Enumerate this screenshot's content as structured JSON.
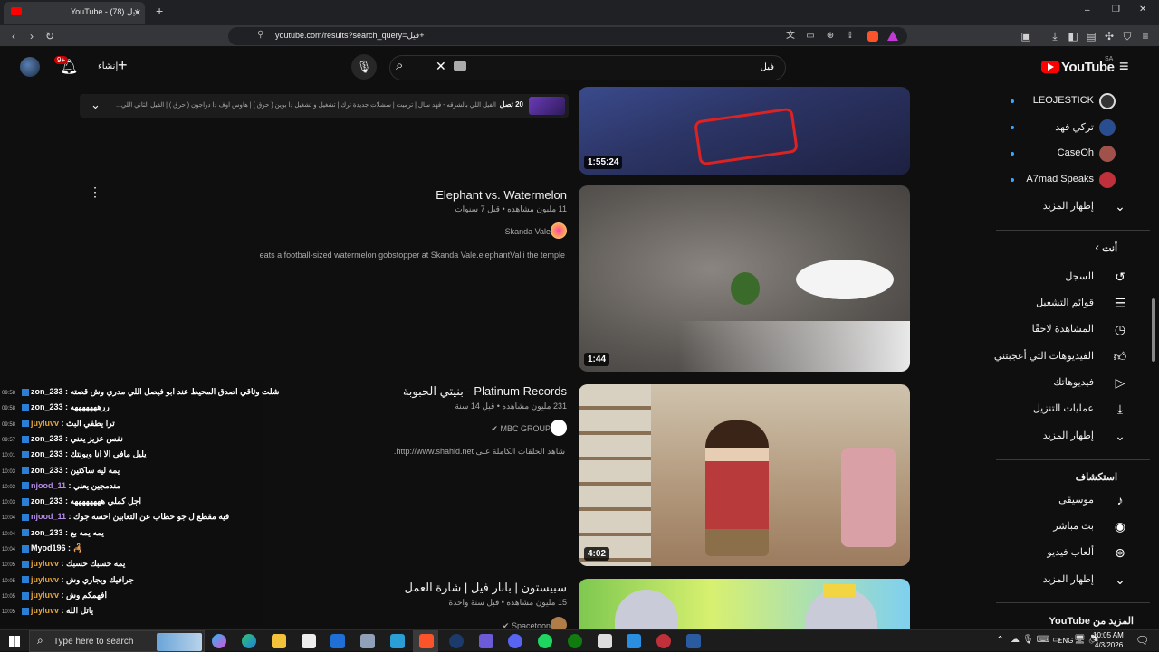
{
  "browser": {
    "tab_title": "YouTube - فيل (78)",
    "tab_close": "×",
    "new_tab": "+",
    "url": "youtube.com/results?search_query=فيل+",
    "window_controls": [
      "–",
      "❐",
      "✕"
    ]
  },
  "header": {
    "logo_text": "YouTube",
    "logo_region": "SA",
    "search_query": "فيل",
    "create_label": "إنشاء",
    "notification_count": "9+"
  },
  "sidebar": {
    "subscriptions": [
      {
        "name": "LEOJESTICK",
        "avatar_color": "#ddd"
      },
      {
        "name": "تركي فهد",
        "avatar_color": "#2a4d8f"
      },
      {
        "name": "CaseOh",
        "avatar_color": "#a0524a"
      },
      {
        "name": "A7mad Speaks",
        "avatar_color": "#c0303a"
      }
    ],
    "show_more_1": "إظهار المزيد",
    "you_heading": "أنت",
    "you_items": [
      {
        "label": "السجل",
        "icon": "history-icon"
      },
      {
        "label": "قوائم التشغيل",
        "icon": "playlist-icon"
      },
      {
        "label": "المشاهدة لاحقًا",
        "icon": "clock-icon"
      },
      {
        "label": "الفيديوهات التي أعجبتني",
        "icon": "thumbs-up-icon"
      },
      {
        "label": "فيديوهاتك",
        "icon": "play-box-icon"
      },
      {
        "label": "عمليات التنزيل",
        "icon": "download-icon"
      }
    ],
    "show_more_2": "إظهار المزيد",
    "explore_heading": "استكشاف",
    "explore_items": [
      {
        "label": "موسيقى",
        "icon": "music-icon"
      },
      {
        "label": "بث مباشر",
        "icon": "live-icon"
      },
      {
        "label": "ألعاب فيديو",
        "icon": "gamepad-icon"
      }
    ],
    "show_more_3": "إظهار المزيد",
    "more_from": "المزيد من YouTube"
  },
  "results": {
    "mix": {
      "count": "20 تصل",
      "text": "الفيل اللي بالشرقه - فهد سال | ترميت | سشلات جديدة ترك | تشغيل و تشغيل دا بوين ( حرق ) | هاوس اوف دا دراجون ( حرق ) | الفيل الثاني اللي..."
    },
    "videos": [
      {
        "duration": "1:55:24"
      },
      {
        "title": "Elephant vs. Watermelon",
        "meta": "11 مليون مشاهده • قبل 7 سنوات",
        "channel": "Skanda Vale",
        "desc": "eats a football-sized watermelon gobstopper at Skanda Vale.elephantValli the temple",
        "duration": "1:44"
      },
      {
        "title": "بنيتي الحبوبة - Platinum Records",
        "meta": "231 مليون مشاهده • قبل 14 سنة",
        "channel": "MBC GROUP",
        "desc": "شاهد الحلقات الكاملة على http://www.shahid.net.",
        "duration": "4:02"
      },
      {
        "title": "سبيستون | بابار فيل | شارة العمل",
        "meta": "15 مليون مشاهده • قبل سنة واحدة",
        "channel": "Spacetoon"
      }
    ]
  },
  "chat": [
    {
      "ts": "09:58",
      "user": "zon_233",
      "color": "#fff",
      "msg": "شلت وثاقي اصدق المحيط عند ابو فيصل اللي مدري وش قصته"
    },
    {
      "ts": "09:58",
      "user": "zon_233",
      "color": "#fff",
      "msg": "ررهههههههه"
    },
    {
      "ts": "09:58",
      "user": "juyluvv",
      "color": "#e6a53a",
      "msg": "ترا يطفي البث"
    },
    {
      "ts": "09:57",
      "user": "zon_233",
      "color": "#fff",
      "msg": "نفس عزيز يعني"
    },
    {
      "ts": "10:01",
      "user": "zon_233",
      "color": "#fff",
      "msg": "يليل مافي الا انا ويونتك"
    },
    {
      "ts": "10:03",
      "user": "zon_233",
      "color": "#fff",
      "msg": "يمه ليه ساكتين"
    },
    {
      "ts": "10:03",
      "user": "njood_11",
      "color": "#b58ce8",
      "msg": "مندمجين يعني"
    },
    {
      "ts": "10:03",
      "user": "zon_233",
      "color": "#fff",
      "msg": "اجل كملي ههههههههه"
    },
    {
      "ts": "10:04",
      "user": "njood_11",
      "color": "#b58ce8",
      "msg": "فيه مقطع ل جو حطاب عن التعابين احسه جوك"
    },
    {
      "ts": "10:04",
      "user": "zon_233",
      "color": "#fff",
      "msg": "يمه يمه بع"
    },
    {
      "ts": "10:04",
      "user": "Myod196",
      "color": "#fff",
      "msg": "🦂"
    },
    {
      "ts": "10:05",
      "user": "juyluvv",
      "color": "#e6a53a",
      "msg": "يمه حسبك حسبك"
    },
    {
      "ts": "10:05",
      "user": "juyluvv",
      "color": "#e6a53a",
      "msg": "جرافيك ويجاري وش"
    },
    {
      "ts": "10:05",
      "user": "juyluvv",
      "color": "#e6a53a",
      "msg": "افهمكم وش"
    },
    {
      "ts": "10:05",
      "user": "juyluvv",
      "color": "#e6a53a",
      "msg": "ياتل الله"
    }
  ],
  "taskbar": {
    "search_placeholder": "Type here to search",
    "lang": "ENG",
    "time": "10:05 AM",
    "date": "4/3/2026"
  }
}
